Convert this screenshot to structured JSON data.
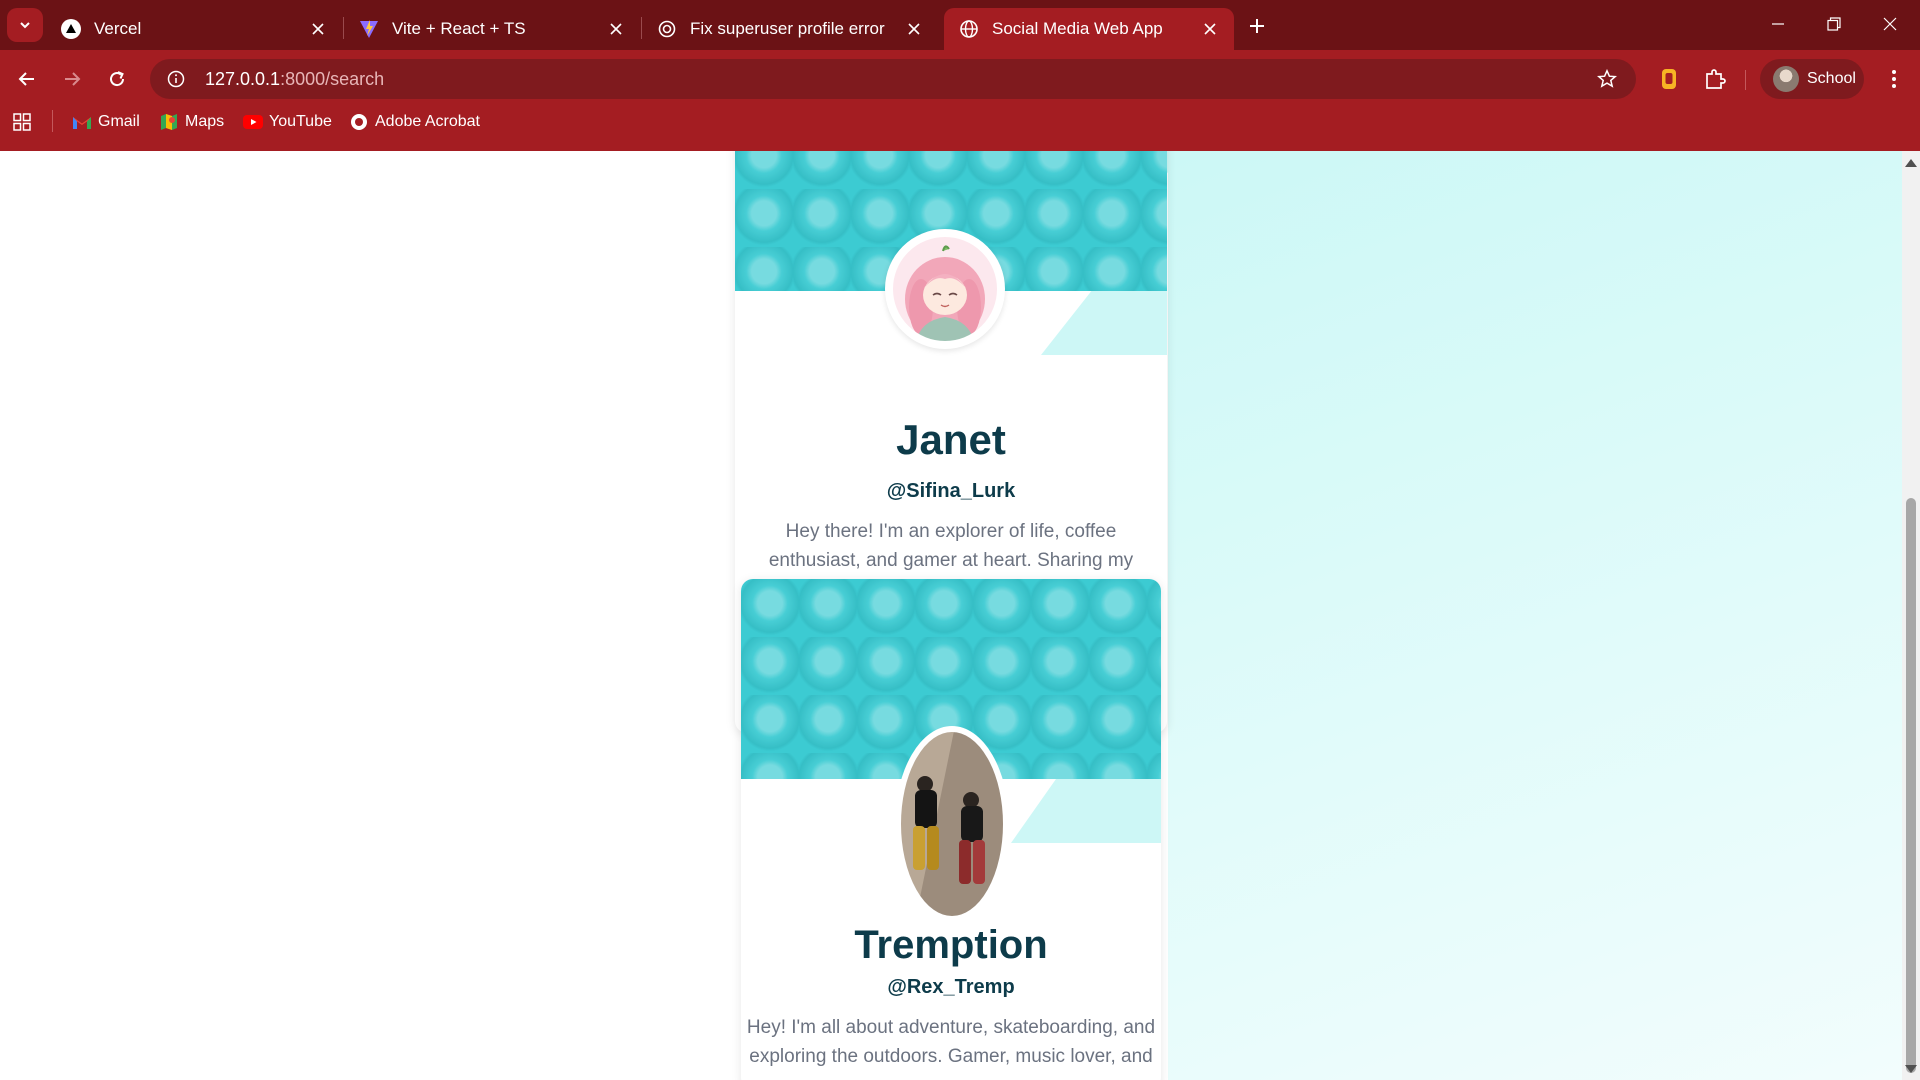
{
  "browser": {
    "tabs": [
      {
        "title": "Vercel",
        "active": false
      },
      {
        "title": "Vite + React + TS",
        "active": false
      },
      {
        "title": "Fix superuser profile error",
        "active": false
      },
      {
        "title": "Social Media Web App",
        "active": true
      }
    ],
    "url_host": "127.0.0.1",
    "url_rest": ":8000/search",
    "profile_label": "School",
    "bookmarks": [
      {
        "label": "Gmail"
      },
      {
        "label": "Maps"
      },
      {
        "label": "YouTube"
      },
      {
        "label": "Adobe Acrobat"
      }
    ],
    "colors": {
      "frame": "#6b1215",
      "toolbar": "#a41d22",
      "omnibox": "#7f1a1e"
    }
  },
  "results": [
    {
      "name": "Janet",
      "handle": "@Sifina_Lurk",
      "bio": "Hey there! I'm an explorer of life, coffee enthusiast, and gamer at heart. Sharing my"
    },
    {
      "name": "Tremption",
      "handle": "@Rex_Tremp",
      "bio": "Hey! I'm all about adventure, skateboarding, and exploring the outdoors. Gamer, music lover, and"
    }
  ],
  "theme": {
    "cover": "#3ccbd2",
    "name_color": "#0d3b4a",
    "accent_bg": "#ccf8f6"
  }
}
